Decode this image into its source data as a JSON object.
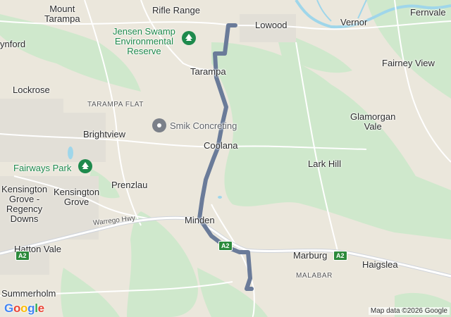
{
  "map": {
    "type": "route-map",
    "route_color": "#6a7b99"
  },
  "places": [
    {
      "id": "mount-tarampa",
      "text": "Mount\nTarampa"
    },
    {
      "id": "rifle-range",
      "text": "Rifle Range"
    },
    {
      "id": "lowood",
      "text": "Lowood"
    },
    {
      "id": "vernor",
      "text": "Vernor"
    },
    {
      "id": "fernvale",
      "text": "Fernvale"
    },
    {
      "id": "wynford",
      "text": "ynford"
    },
    {
      "id": "tarampa",
      "text": "Tarampa"
    },
    {
      "id": "fairney-view",
      "text": "Fairney View"
    },
    {
      "id": "lockrose",
      "text": "Lockrose"
    },
    {
      "id": "tarampa-flat",
      "text": "TARAMPA FLAT"
    },
    {
      "id": "glamorgan-vale",
      "text": "Glamorgan\nVale"
    },
    {
      "id": "brightview",
      "text": "Brightview"
    },
    {
      "id": "coolana",
      "text": "Coolana"
    },
    {
      "id": "lark-hill",
      "text": "Lark Hill"
    },
    {
      "id": "prenzlau",
      "text": "Prenzlau"
    },
    {
      "id": "kensington-grove-regency-downs",
      "text": "Kensington\nGrove -\nRegency\nDowns"
    },
    {
      "id": "kensington-grove",
      "text": "Kensington\nGrove"
    },
    {
      "id": "minden",
      "text": "Minden"
    },
    {
      "id": "hatton-vale",
      "text": "Hatton Vale"
    },
    {
      "id": "marburg",
      "text": "Marburg"
    },
    {
      "id": "haigslea",
      "text": "Haigslea"
    },
    {
      "id": "malabar",
      "text": "MALABAR"
    },
    {
      "id": "summerholm",
      "text": "Summerholm"
    }
  ],
  "parks": [
    {
      "id": "jensen-swamp",
      "text": "Jensen Swamp\nEnvironmental\nReserve"
    },
    {
      "id": "fairways-park",
      "text": "Fairways Park"
    }
  ],
  "pois": [
    {
      "id": "smik-concreting",
      "text": "Smik Concreting"
    }
  ],
  "roads": [
    {
      "id": "warrego-hwy",
      "text": "Warrego Hwy"
    }
  ],
  "shields": [
    {
      "id": "a2-west",
      "text": "A2"
    },
    {
      "id": "a2-minden",
      "text": "A2"
    },
    {
      "id": "a2-marburg",
      "text": "A2"
    }
  ],
  "branding": {
    "logo_text": "Google",
    "attribution": "Map data ©2026 Google",
    "colors": {
      "g_blue": "#4285F4",
      "g_red": "#EA4335",
      "g_yellow": "#FBBC05",
      "g_green": "#34A853"
    }
  }
}
